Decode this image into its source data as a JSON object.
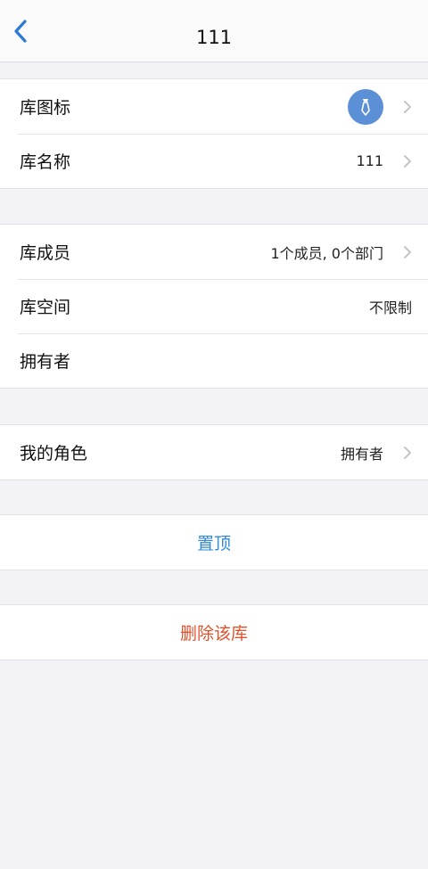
{
  "nav": {
    "title": "111"
  },
  "library": {
    "icon_label": "库图标",
    "name_label": "库名称",
    "name_value": "111"
  },
  "info": {
    "members_label": "库成员",
    "members_value": "1个成员, 0个部门",
    "space_label": "库空间",
    "space_value": "不限制",
    "owner_label": "拥有者",
    "owner_value": ""
  },
  "role": {
    "label": "我的角色",
    "value": "拥有者"
  },
  "actions": {
    "pin_label": "置顶",
    "delete_label": "删除该库"
  },
  "colors": {
    "accent_blue": "#2c8ad6",
    "danger": "#e0522d",
    "avatar_bg": "#5b8fd6"
  },
  "icons": {
    "back": "chevron-left-icon",
    "library_icon": "tie-icon",
    "row_chevron": "chevron-right-icon"
  }
}
